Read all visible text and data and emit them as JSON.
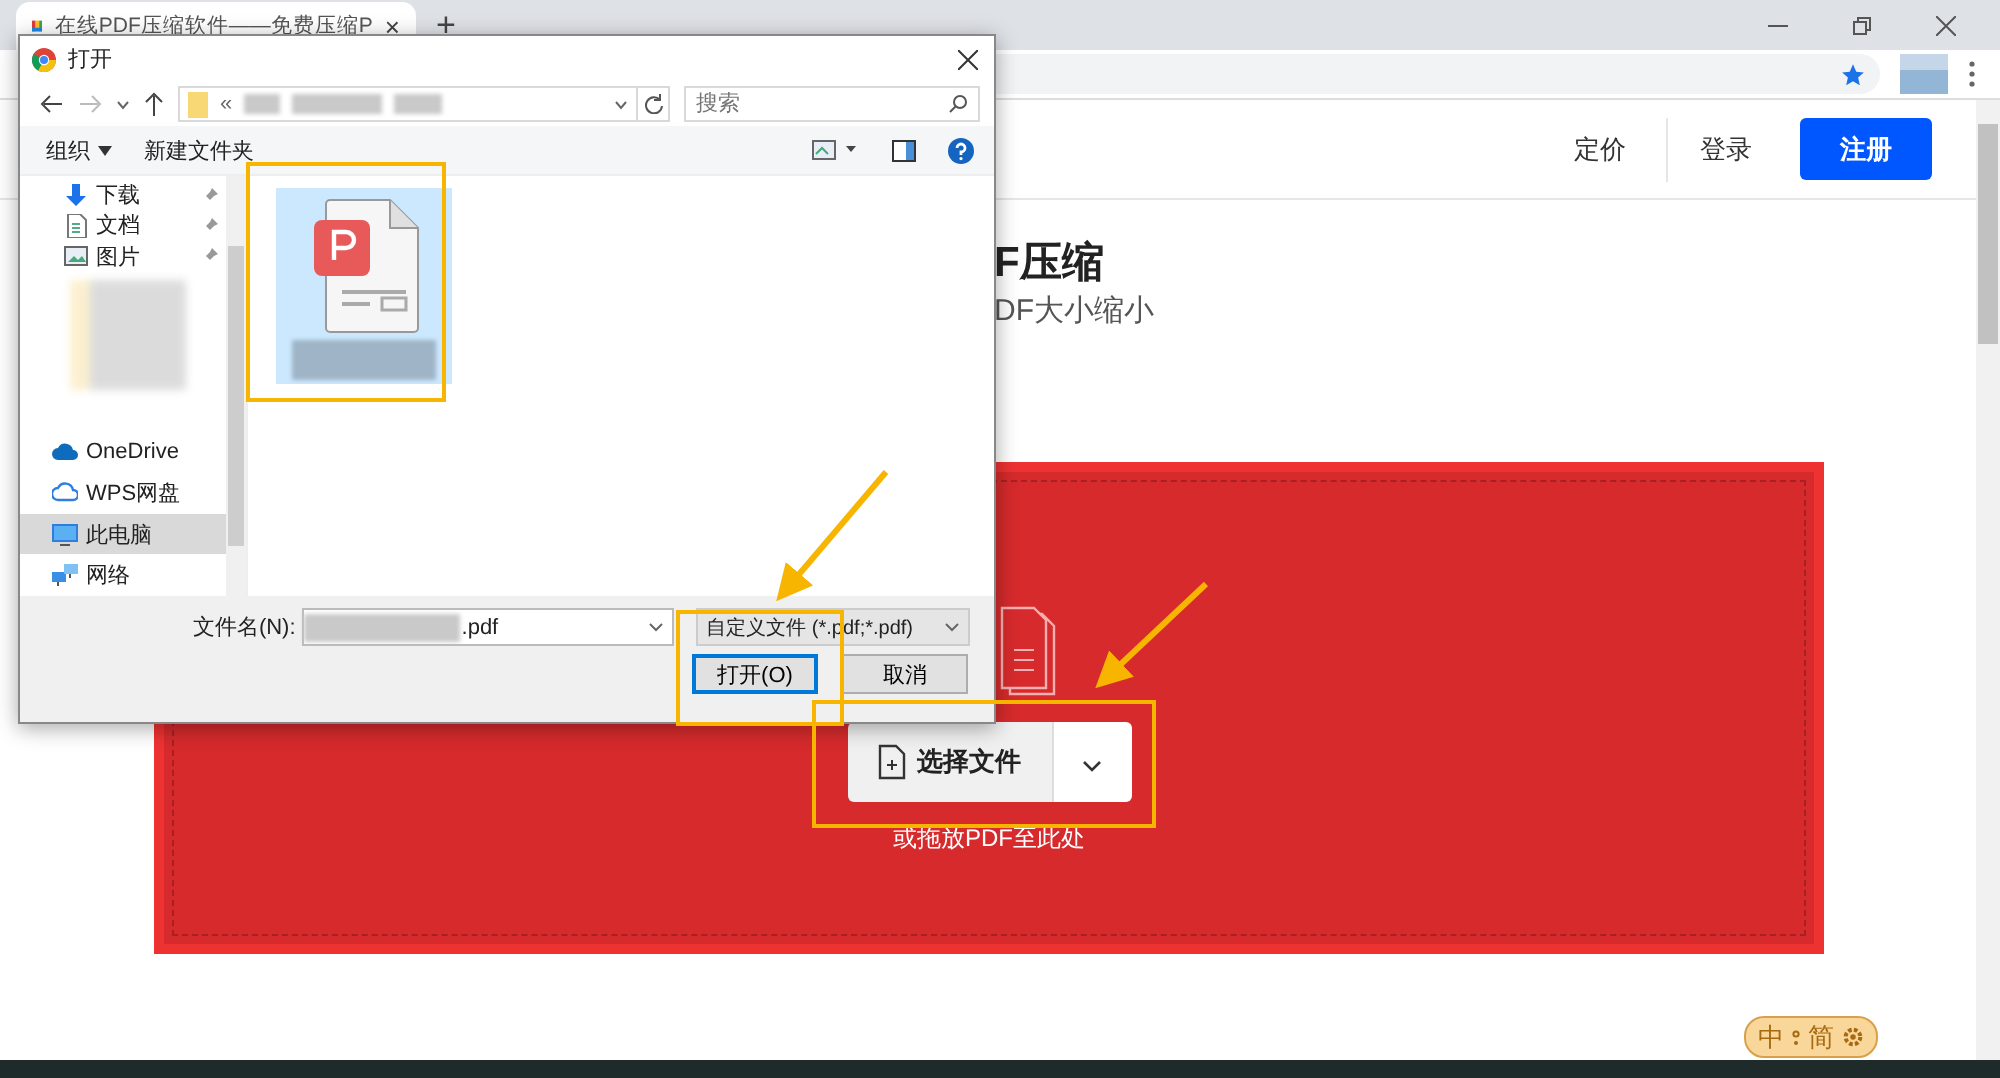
{
  "browser": {
    "tab_title": "在线PDF压缩软件——免费压缩P",
    "tab_close": "×",
    "new_tab": "+"
  },
  "page": {
    "nav": [
      {
        "label": "定价"
      },
      {
        "label": "登录"
      }
    ],
    "signup": "注册",
    "title": "F压缩",
    "subtitle": "DF大小缩小",
    "upload_button": "选择文件",
    "drop_hint": "或拖放PDF至此处"
  },
  "dialog": {
    "title": "打开",
    "path_prefix": "«",
    "search_placeholder": "搜索",
    "toolbar": [
      "组织",
      "新建文件夹"
    ],
    "quick_access": [
      {
        "label": "下载",
        "kind": "download",
        "pinned": true,
        "selected": false
      },
      {
        "label": "文档",
        "kind": "document",
        "pinned": true,
        "selected": false
      },
      {
        "label": "图片",
        "kind": "image",
        "pinned": true,
        "selected": false
      }
    ],
    "locations": [
      {
        "label": "OneDrive",
        "kind": "cloud",
        "pinned": false,
        "selected": false
      },
      {
        "label": "WPS网盘",
        "kind": "cloud-outline",
        "pinned": false,
        "selected": false
      },
      {
        "label": "此电脑",
        "kind": "computer",
        "pinned": false,
        "selected": true
      },
      {
        "label": "网络",
        "kind": "network",
        "pinned": false,
        "selected": false
      }
    ],
    "file_name_label": "文件名(N):",
    "file_name_suffix": ".pdf",
    "file_type": "自定义文件 (*.pdf;*.pdf)",
    "buttons": [
      {
        "label": "打开(O)",
        "default": true
      },
      {
        "label": "取消",
        "default": false
      }
    ]
  },
  "ime": {
    "items": [
      "中",
      "简"
    ]
  }
}
